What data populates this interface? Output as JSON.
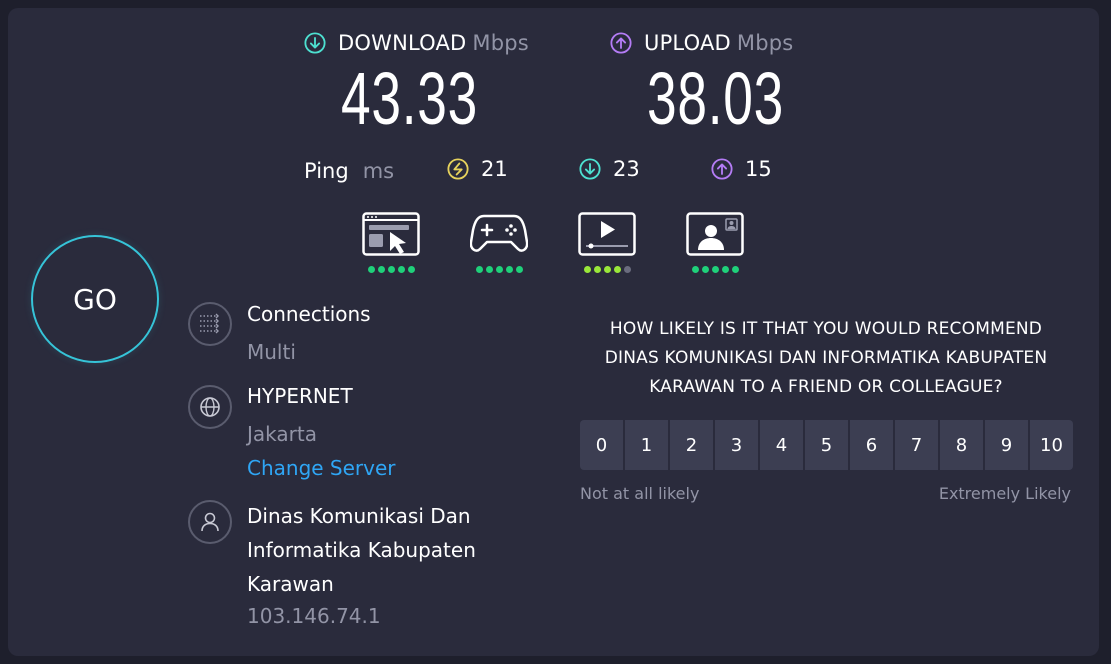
{
  "download": {
    "label": "DOWNLOAD",
    "unit": "Mbps",
    "value": "43.33",
    "icon": "arrow-down-circle-icon",
    "color": "#4de0d0"
  },
  "upload": {
    "label": "UPLOAD",
    "unit": "Mbps",
    "value": "38.03",
    "icon": "arrow-up-circle-icon",
    "color": "#b47cf5"
  },
  "ping": {
    "label": "Ping",
    "unit": "ms",
    "idle": {
      "value": "21",
      "icon": "jitter-circle-icon",
      "color": "#e6d25c"
    },
    "download": {
      "value": "23",
      "icon": "arrow-down-circle-icon",
      "color": "#4de0d0"
    },
    "upload": {
      "value": "15",
      "icon": "arrow-up-circle-icon",
      "color": "#b47cf5"
    }
  },
  "quality": [
    {
      "name": "web-browsing-icon",
      "rating": 5,
      "of": 5
    },
    {
      "name": "gaming-icon",
      "rating": 5,
      "of": 5
    },
    {
      "name": "video-streaming-icon",
      "rating": 4,
      "of": 5
    },
    {
      "name": "video-chat-icon",
      "rating": 5,
      "of": 5
    }
  ],
  "go_label": "GO",
  "connections": {
    "title": "Connections",
    "value": "Multi",
    "icon": "connections-icon"
  },
  "server": {
    "title": "HYPERNET",
    "location": "Jakarta",
    "change_label": "Change Server",
    "icon": "globe-icon"
  },
  "provider": {
    "name_line1": "Dinas Komunikasi Dan",
    "name_line2": "Informatika Kabupaten",
    "name_line3": "Karawan",
    "ip": "103.146.74.1",
    "icon": "user-icon"
  },
  "survey": {
    "question_line1": "HOW LIKELY IS IT THAT YOU WOULD RECOMMEND",
    "question_line2": "DINAS KOMUNIKASI DAN INFORMATIKA KABUPATEN",
    "question_line3": "KARAWAN TO A FRIEND OR COLLEAGUE?",
    "options": [
      "0",
      "1",
      "2",
      "3",
      "4",
      "5",
      "6",
      "7",
      "8",
      "9",
      "10"
    ],
    "low_label": "Not at all likely",
    "high_label": "Extremely Likely"
  }
}
